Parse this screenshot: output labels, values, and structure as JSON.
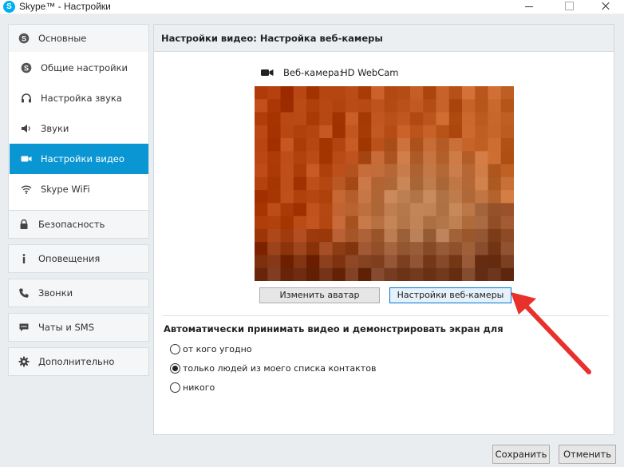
{
  "window": {
    "title": "Skype™ - Настройки"
  },
  "sidebar": {
    "general": "Основные",
    "general_items": [
      {
        "label": "Общие настройки",
        "icon": "skype-icon"
      },
      {
        "label": "Настройка звука",
        "icon": "headset-icon"
      },
      {
        "label": "Звуки",
        "icon": "speaker-icon"
      },
      {
        "label": "Настройки видео",
        "icon": "video-camera-icon",
        "active": true
      },
      {
        "label": "Skype WiFi",
        "icon": "wifi-icon"
      }
    ],
    "sections": [
      {
        "label": "Безопасность",
        "icon": "lock-icon"
      },
      {
        "label": "Оповещения",
        "icon": "info-icon"
      },
      {
        "label": "Звонки",
        "icon": "phone-icon"
      },
      {
        "label": "Чаты и SMS",
        "icon": "chat-icon"
      },
      {
        "label": "Дополнительно",
        "icon": "gear-icon"
      }
    ]
  },
  "content": {
    "title": "Настройки видео: Настройка веб-камеры",
    "webcam_label": "Веб-камера:",
    "webcam_name": "HD WebCam",
    "change_avatar_label": "Изменить аватар",
    "webcam_settings_label": "Настройки веб-камеры",
    "auto_accept_title": "Автоматически принимать видео и демонстрировать экран для",
    "options": [
      {
        "label": "от кого угодно",
        "checked": false
      },
      {
        "label": "только людей из моего списка контактов",
        "checked": true
      },
      {
        "label": "никого",
        "checked": false
      }
    ]
  },
  "footer": {
    "save_label": "Сохранить",
    "cancel_label": "Отменить"
  },
  "colors": {
    "accent": "#0a96d2",
    "annotation_arrow": "#e8302c"
  }
}
